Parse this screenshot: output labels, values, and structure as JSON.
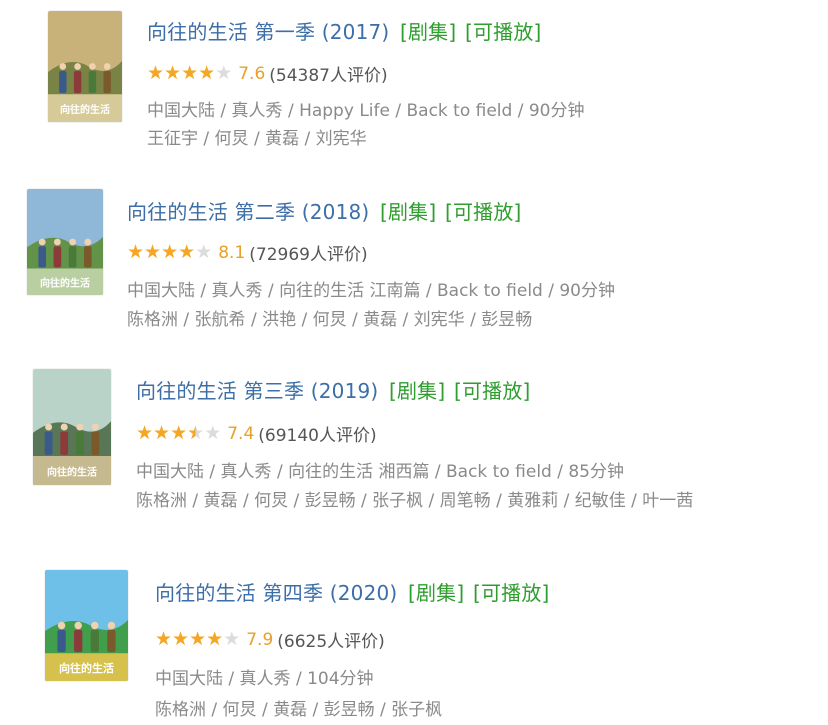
{
  "colors": {
    "title": "#3c6ea8",
    "tag": "#2f9e2f",
    "star_filled": "#f5a623",
    "star_empty": "#dcdcdc",
    "score": "#e8a027",
    "meta": "#8a8a8a"
  },
  "entries": [
    {
      "title": "向往的生活 第一季 (2017)",
      "tag_episodes": "[剧集]",
      "tag_play": "[可播放]",
      "stars": 4,
      "score": "7.6",
      "votes": "(54387人评价)",
      "meta": "中国大陆 / 真人秀 / Happy Life / Back to field / 90分钟",
      "cast": "王征宇 / 何炅 / 黄磊 / 刘宪华",
      "poster_colors": [
        "#c9b27a",
        "#6f7d3f",
        "#e6d7a8"
      ],
      "poster_label": "向往的生活"
    },
    {
      "title": "向往的生活 第二季 (2018)",
      "tag_episodes": "[剧集]",
      "tag_play": "[可播放]",
      "stars": 4,
      "score": "8.1",
      "votes": "(72969人评价)",
      "meta": "中国大陆 / 真人秀 / 向往的生活 江南篇 / Back to field / 90分钟",
      "cast": "陈格洲 / 张航希 / 洪艳 / 何炅 / 黄磊 / 刘宪华 / 彭昱畅",
      "poster_colors": [
        "#8fb7d8",
        "#5d8f3a",
        "#c9d9b1"
      ],
      "poster_label": "向往的生活"
    },
    {
      "title": "向往的生活 第三季 (2019)",
      "tag_episodes": "[剧集]",
      "tag_play": "[可播放]",
      "stars": 3.5,
      "score": "7.4",
      "votes": "(69140人评价)",
      "meta": "中国大陆 / 真人秀 / 向往的生活 湘西篇 / Back to field / 85分钟",
      "cast": "陈格洲 / 黄磊 / 何炅 / 彭昱畅 / 张子枫 / 周笔畅 / 黄雅莉 / 纪敏佳 / 叶一茜",
      "poster_colors": [
        "#b9d3c9",
        "#4f6b4a",
        "#d8c59a"
      ],
      "poster_label": "向往的生活"
    },
    {
      "title": "向往的生活 第四季 (2020)",
      "tag_episodes": "[剧集]",
      "tag_play": "[可播放]",
      "stars": 4,
      "score": "7.9",
      "votes": "(6625人评价)",
      "meta": "中国大陆 / 真人秀 / 104分钟",
      "cast": "陈格洲 / 何炅 / 黄磊 / 彭昱畅 / 张子枫",
      "poster_colors": [
        "#6ec0e8",
        "#3c9a3c",
        "#f2c74d"
      ],
      "poster_label": "向往的生活"
    }
  ]
}
